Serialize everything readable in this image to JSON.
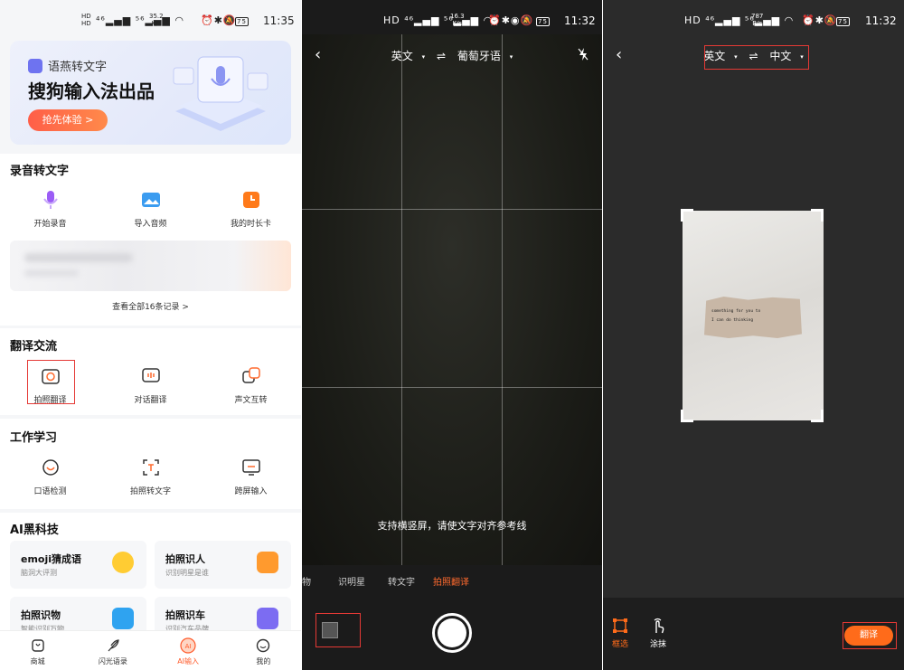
{
  "left_panel": {
    "status_bar": {
      "network_top": "HD",
      "network_bottom": "HD",
      "speed_value": "35.2",
      "speed_unit": "K/s",
      "battery": "75",
      "time": "11:35"
    },
    "banner": {
      "brand": "语燕转文字",
      "headline": "搜狗输入法出品",
      "cta": "抢先体验 >"
    },
    "recording": {
      "title": "录音转文字",
      "items": [
        {
          "label": "开始录音",
          "icon": "mic-icon",
          "color": "#9b5cf6"
        },
        {
          "label": "导入音频",
          "icon": "image-icon",
          "color": "#3b9cf0"
        },
        {
          "label": "我的时长卡",
          "icon": "clock-icon",
          "color": "#ff7a1a"
        }
      ],
      "view_all": "查看全部16条记录 >"
    },
    "translate": {
      "title": "翻译交流",
      "items": [
        {
          "label": "拍照翻译",
          "icon": "camera-translate-icon"
        },
        {
          "label": "对话翻译",
          "icon": "chat-translate-icon"
        },
        {
          "label": "声文互转",
          "icon": "voice-text-icon"
        }
      ]
    },
    "study": {
      "title": "工作学习",
      "items": [
        {
          "label": "口语检测",
          "icon": "speech-check-icon"
        },
        {
          "label": "拍照转文字",
          "icon": "photo-text-icon"
        },
        {
          "label": "跨屏输入",
          "icon": "cross-screen-icon"
        }
      ]
    },
    "ai": {
      "title": "AI黑科技",
      "tiles": [
        {
          "title": "emoji猜成语",
          "subtitle": "脑洞大评测",
          "icon": "emoji-icon"
        },
        {
          "title": "拍照识人",
          "subtitle": "识别明星是谁",
          "icon": "person-card-icon"
        },
        {
          "title": "拍照识物",
          "subtitle": "智能识别万物",
          "icon": "cube-icon"
        },
        {
          "title": "拍照识车",
          "subtitle": "识别汽车品牌",
          "icon": "car-icon"
        }
      ]
    },
    "tabs": [
      {
        "label": "商城",
        "icon": "shop-icon"
      },
      {
        "label": "闪光语录",
        "icon": "feather-icon"
      },
      {
        "label": "AI输入",
        "icon": "ai-icon"
      },
      {
        "label": "我的",
        "icon": "profile-icon"
      }
    ]
  },
  "middle_panel": {
    "status_bar": {
      "speed_value": "16.3",
      "speed_unit": "K/s",
      "battery": "75",
      "time": "11:32"
    },
    "source_lang": "英文",
    "target_lang": "葡萄牙语",
    "swap_symbol": "⇌",
    "hint": "支持横竖屏，请使文字对齐参考线",
    "modes": [
      "物",
      "识明星",
      "转文字",
      "拍照翻译"
    ],
    "active_mode": "拍照翻译"
  },
  "right_panel": {
    "status_bar": {
      "speed_value": "787",
      "speed_unit": "B/s",
      "battery": "75",
      "time": "11:32"
    },
    "source_lang": "英文",
    "target_lang": "中文",
    "swap_symbol": "⇌",
    "photo_text_line1": "something for you to",
    "photo_text_line2": "I can do thinking",
    "tools": [
      {
        "label": "框选",
        "icon": "frame-select-icon",
        "color": "#ff6b1a"
      },
      {
        "label": "涂抹",
        "icon": "touch-smear-icon",
        "color": "#ffffff"
      }
    ],
    "translate_button": "翻译"
  }
}
